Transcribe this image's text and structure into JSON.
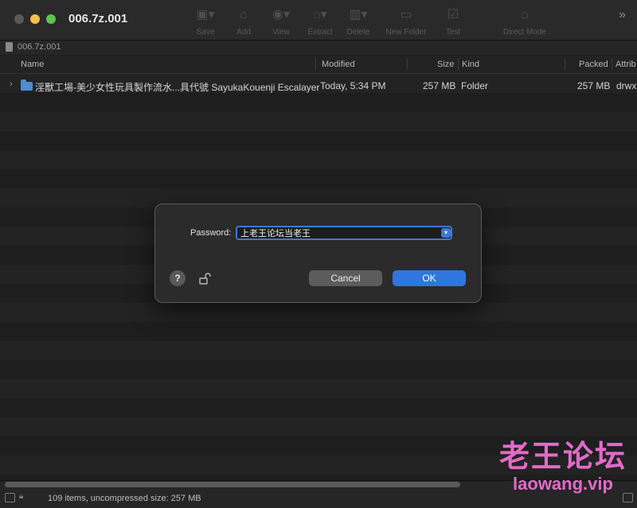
{
  "window": {
    "title": "006.7z.001"
  },
  "toolbar": {
    "items": [
      {
        "label": "Save",
        "icon": "save-icon"
      },
      {
        "label": "Add",
        "icon": "add-icon"
      },
      {
        "label": "View",
        "icon": "view-icon"
      },
      {
        "label": "Extract",
        "icon": "extract-icon"
      },
      {
        "label": "Delete",
        "icon": "delete-icon"
      },
      {
        "label": "New Folder",
        "icon": "new-folder-icon"
      },
      {
        "label": "Test",
        "icon": "test-icon"
      },
      {
        "label": "Direct Mode",
        "icon": "direct-mode-icon"
      }
    ]
  },
  "pathbar": {
    "path": "006.7z.001"
  },
  "columns": {
    "name": "Name",
    "modified": "Modified",
    "size": "Size",
    "kind": "Kind",
    "packed": "Packed",
    "attributes": "Attrib"
  },
  "rows": [
    {
      "name": "淫獸工場-美少女性玩具製作流水...具代號 SayukaKouenji Escalayer",
      "modified": "Today, 5:34 PM",
      "size": "257 MB",
      "kind": "Folder",
      "packed": "257 MB",
      "attributes": "drwx"
    }
  ],
  "dialog": {
    "password_label": "Password:",
    "password_value": "上老王论坛当老王",
    "help_label": "?",
    "cancel_label": "Cancel",
    "ok_label": "OK"
  },
  "status": {
    "text": "109 items, uncompressed size: 257 MB"
  },
  "watermark": {
    "line1": "老王论坛",
    "line2": "laowang.vip"
  },
  "colors": {
    "accent": "#2f76e0",
    "background": "#1e1e1e",
    "watermark": "#e26bc8"
  }
}
